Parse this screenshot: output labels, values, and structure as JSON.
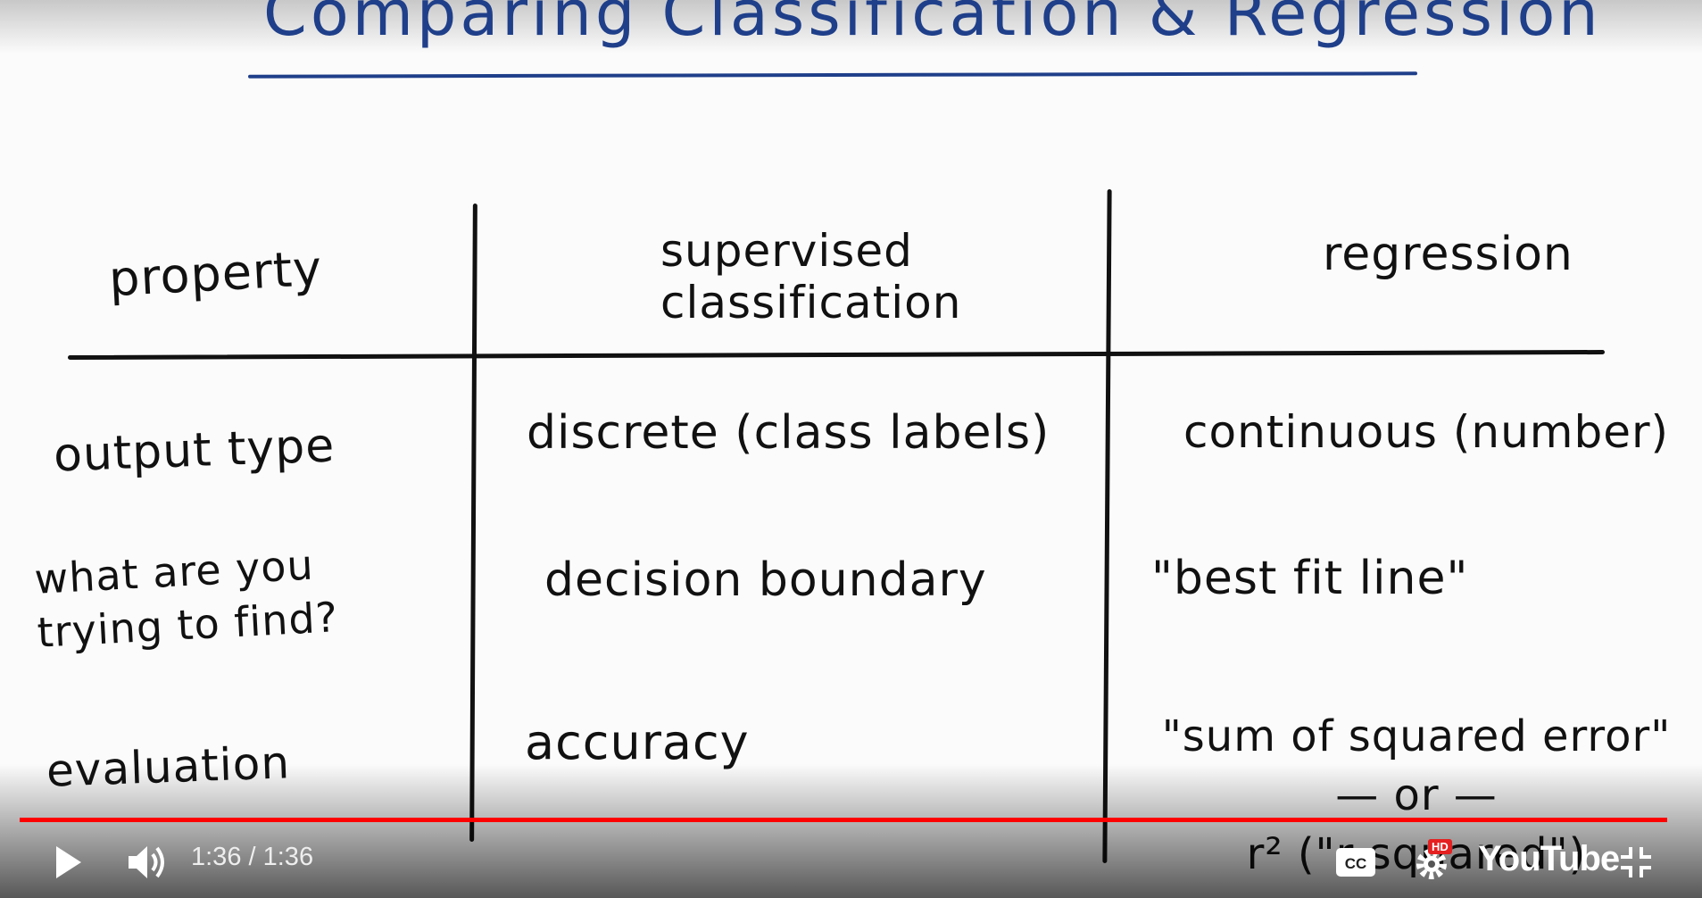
{
  "video": {
    "title": "Comparing Classification & Regression",
    "table": {
      "headers": [
        "property",
        "supervised\nclassification",
        "regression"
      ],
      "rows": [
        {
          "property": "output type",
          "classification": "discrete (class labels)",
          "regression": "continuous (number)"
        },
        {
          "property": "what are you\ntrying to find?",
          "classification": "decision boundary",
          "regression": "\"best fit line\""
        },
        {
          "property": "evaluation",
          "classification": "accuracy",
          "regression": "\"sum of squared error\"\n— or —\nr² (\"r squared\")"
        }
      ]
    }
  },
  "controls": {
    "play_icon": "play-icon",
    "volume_icon": "volume-icon",
    "time_current": "1:36",
    "time_sep": " / ",
    "time_total": "1:36",
    "progress": 1.0,
    "cc_icon": "cc-icon",
    "settings_icon": "gear-icon",
    "hd_badge": "HD",
    "logo": "YouTube",
    "exit_fullscreen_icon": "exit-fullscreen-icon"
  },
  "colors": {
    "progress": "#ff0000",
    "title_ink": "#1f3f8a",
    "ink": "#111111",
    "hd_badge": "#e52020"
  }
}
